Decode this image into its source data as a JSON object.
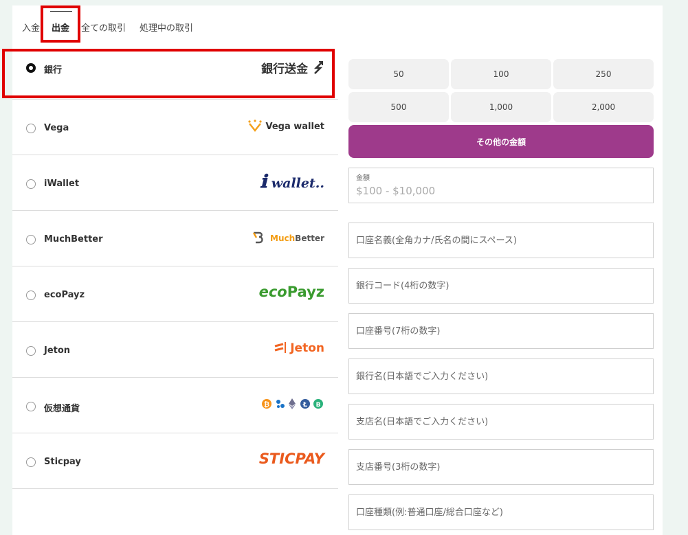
{
  "tabs": [
    {
      "label": "入金"
    },
    {
      "label": "出金"
    },
    {
      "label": "全ての取引"
    },
    {
      "label": "処理中の取引"
    }
  ],
  "methods": [
    {
      "label": "銀行",
      "logo_text": "銀行送金",
      "selected": true
    },
    {
      "label": "Vega",
      "logo_text": "Vega wallet"
    },
    {
      "label": "iWallet",
      "logo_text": "wallet.."
    },
    {
      "label": "MuchBetter",
      "logo_text_a": "Much",
      "logo_text_b": "Better"
    },
    {
      "label": "ecoPayz",
      "logo_text_a": "eco",
      "logo_text_b": "Payz"
    },
    {
      "label": "Jeton",
      "logo_text": "Jeton"
    },
    {
      "label": "仮想通貨",
      "logo_text": "₿ ✦ ◆ Ł ฿"
    },
    {
      "label": "Sticpay",
      "logo_text": "STICPAY"
    }
  ],
  "amounts": [
    "50",
    "100",
    "250",
    "500",
    "1,000",
    "2,000"
  ],
  "other_amount_label": "その他の金額",
  "amount_field": {
    "label": "金額",
    "placeholder": "$100 - $10,000"
  },
  "fields": [
    {
      "placeholder": "口座名義(全角カナ/氏名の間にスペース)"
    },
    {
      "placeholder": "銀行コード(4桁の数字)"
    },
    {
      "placeholder": "口座番号(7桁の数字)"
    },
    {
      "placeholder": "銀行名(日本語でご入力ください)"
    },
    {
      "placeholder": "支店名(日本語でご入力ください)"
    },
    {
      "placeholder": "支店番号(3桁の数字)"
    },
    {
      "placeholder": "口座種類(例:普通口座/総合口座など)"
    }
  ],
  "colors": {
    "accent": "#9e3a8b",
    "highlight_box": "#e00000",
    "background": "#eef5f2",
    "vega_orange": "#f4a01c",
    "iwallet_navy": "#1b2a6b",
    "muchbetter_orange": "#f39c12",
    "ecopayz_green": "#3a9b2f",
    "jeton_orange": "#f26522",
    "sticpay_orange": "#ea5a1d"
  }
}
